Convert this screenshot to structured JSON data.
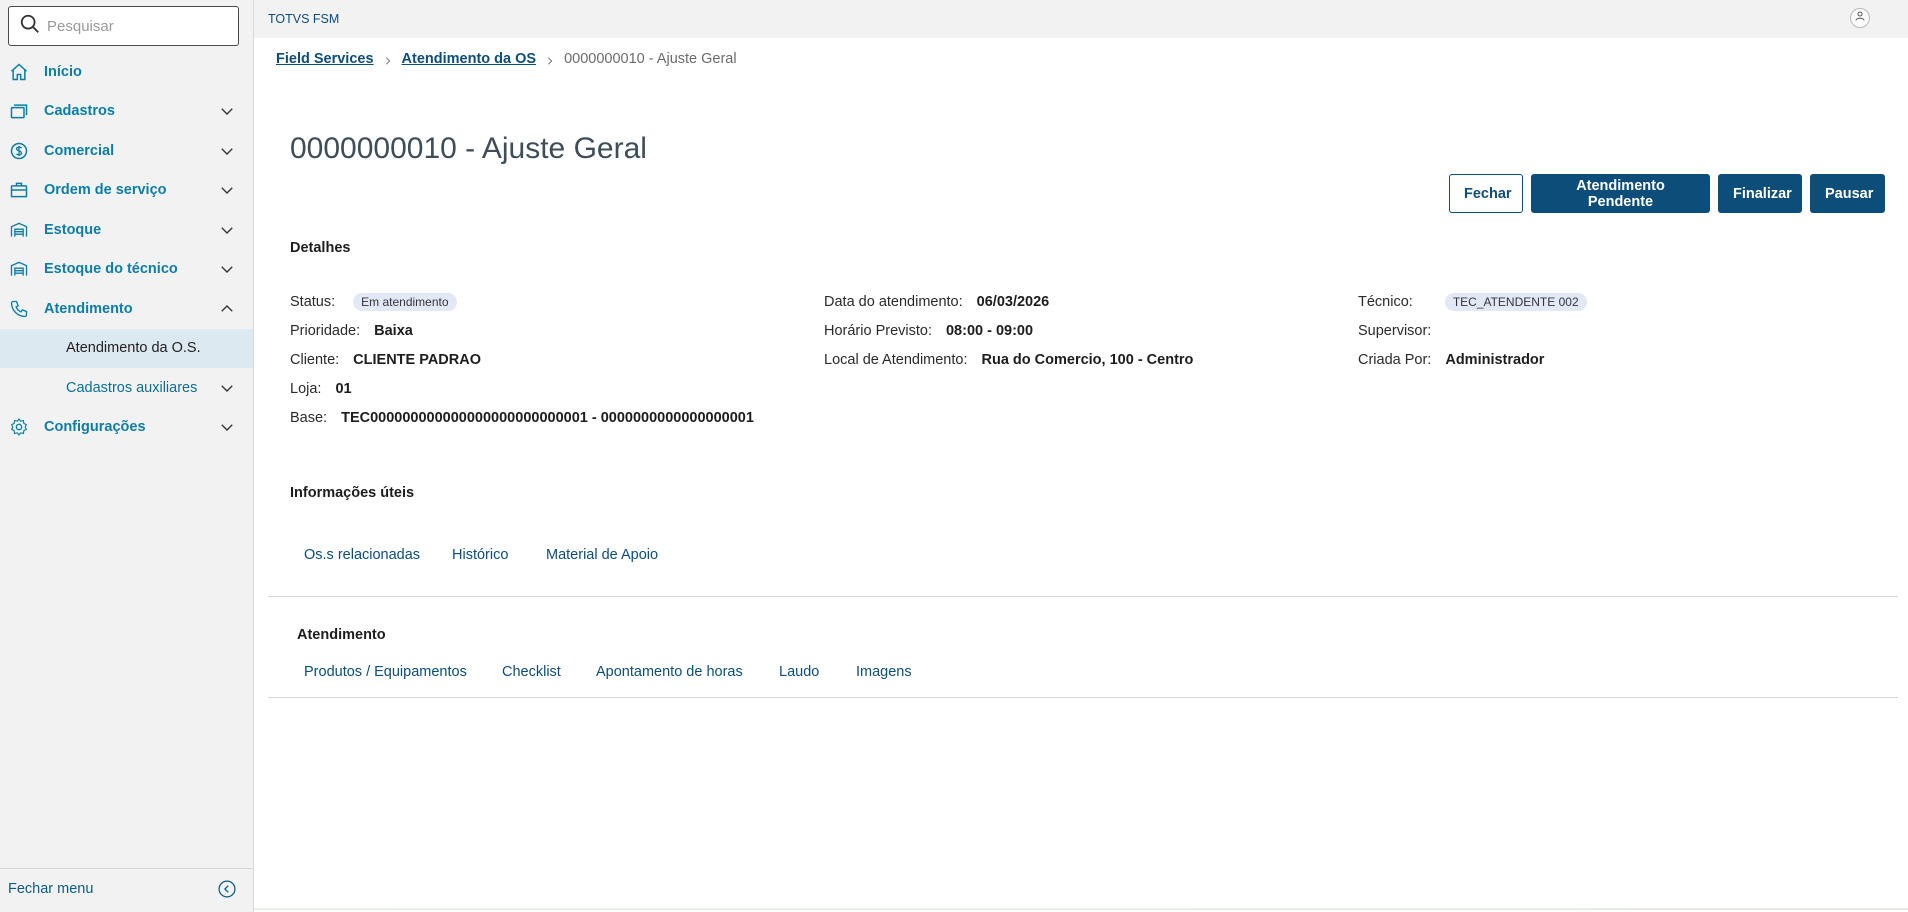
{
  "search": {
    "placeholder": "Pesquisar"
  },
  "sidebar": {
    "items": [
      {
        "label": "Início"
      },
      {
        "label": "Cadastros"
      },
      {
        "label": "Comercial"
      },
      {
        "label": "Ordem de serviço"
      },
      {
        "label": "Estoque"
      },
      {
        "label": "Estoque do técnico"
      },
      {
        "label": "Atendimento"
      },
      {
        "label": "Atendimento da O.S."
      },
      {
        "label": "Cadastros auxiliares"
      },
      {
        "label": "Configurações"
      }
    ],
    "footer_label": "Fechar menu"
  },
  "topbar": {
    "brand": "TOTVS FSM"
  },
  "breadcrumb": {
    "items": [
      "Field Services",
      "Atendimento da OS"
    ],
    "current": "0000000010 - Ajuste Geral"
  },
  "page": {
    "title": "0000000010 - Ajuste Geral"
  },
  "actions": {
    "close": "Fechar",
    "pending": "Atendimento Pendente",
    "finish": "Finalizar",
    "pause": "Pausar"
  },
  "details": {
    "title": "Detalhes",
    "status_label": "Status:",
    "status_value": "Em atendimento",
    "priority_label": "Prioridade:",
    "priority_value": "Baixa",
    "client_label": "Cliente:",
    "client_value": "CLIENTE PADRAO",
    "store_label": "Loja:",
    "store_value": "01",
    "base_label": "Base:",
    "base_value": "TEC000000000000000000000000001 - 0000000000000000001",
    "date_label": "Data do atendimento:",
    "date_value": "06/03/2026",
    "time_label": "Horário Previsto:",
    "time_value": "08:00 - 09:00",
    "location_label": "Local de Atendimento:",
    "location_value": "Rua do Comercio, 100 - Centro",
    "tech_label": "Técnico:",
    "tech_value": "TEC_ATENDENTE 002",
    "supervisor_label": "Supervisor:",
    "created_label": "Criada Por:",
    "created_value": "Administrador"
  },
  "info": {
    "title": "Informações úteis",
    "tabs": [
      "Os.s relacionadas",
      "Histórico",
      "Material de Apoio"
    ]
  },
  "service": {
    "title": "Atendimento",
    "tabs": [
      "Produtos / Equipamentos",
      "Checklist",
      "Apontamento de horas",
      "Laudo",
      "Imagens"
    ]
  },
  "colors": {
    "primary": "#0c4d7a",
    "link": "#0c7ea6",
    "active_bg": "#dde9f1",
    "sidebar_bg": "#f2f2f2"
  }
}
